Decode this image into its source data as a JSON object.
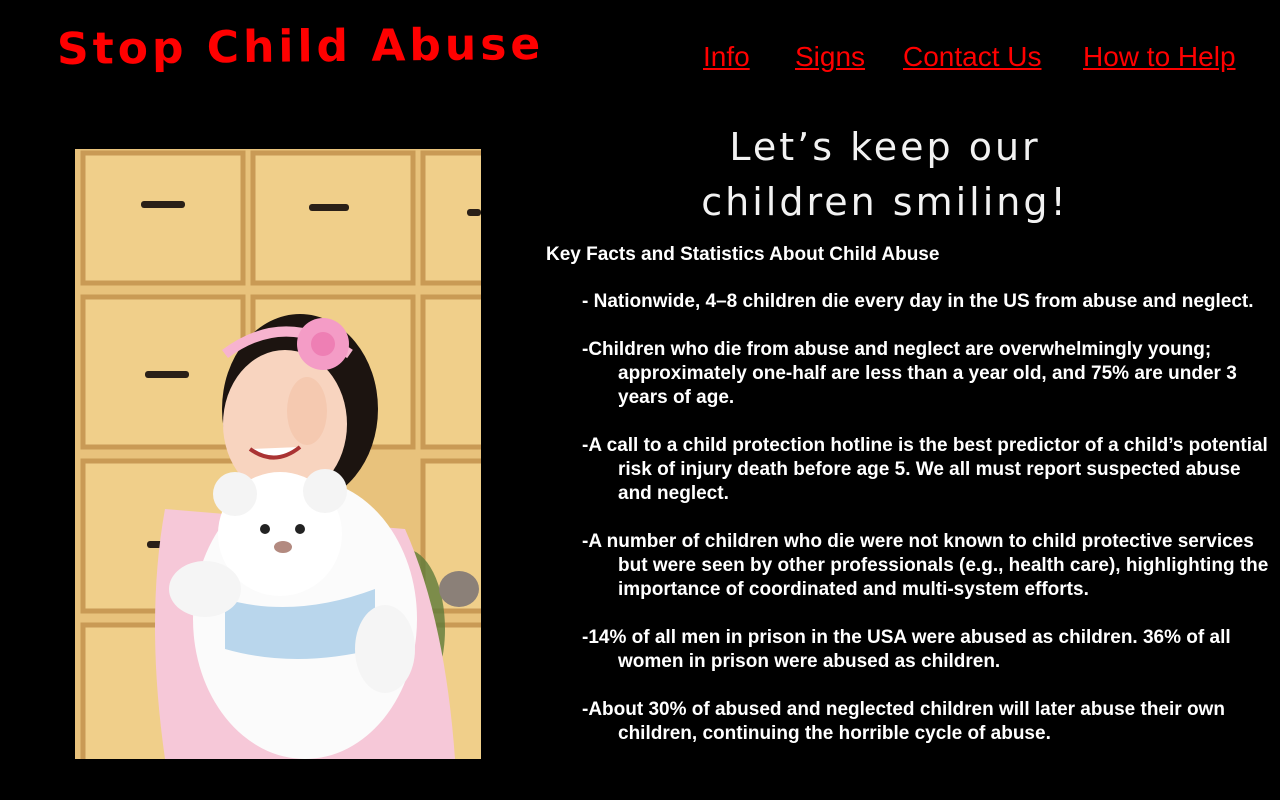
{
  "site": {
    "title": "Stop Child Abuse"
  },
  "nav": {
    "items": [
      {
        "label": "Info"
      },
      {
        "label": "Signs"
      },
      {
        "label": "Contact Us"
      },
      {
        "label": "How to Help"
      }
    ]
  },
  "hero": {
    "tagline_line1": "Let’s keep our",
    "tagline_line2": "children smiling!"
  },
  "facts": {
    "heading": "Key Facts and Statistics About Child Abuse",
    "items": [
      "- Nationwide, 4–8 children die every day in the US from abuse and neglect.",
      "-Children who die from abuse and neglect are overwhelmingly young; approximately one-half are less than a year old, and 75% are under 3 years of age.",
      "-A call to a child protection hotline is the best predictor of a child’s potential risk of injury death before age 5. We all must report suspected abuse and neglect.",
      "-A number of children who die were not known to child protective services but were seen by other professionals (e.g., health care), highlighting the importance of coordinated and multi-system efforts.",
      "-14% of all men in prison in the USA were abused as children. 36% of all women in prison were abused as children.",
      "-About 30% of abused and neglected children will later abuse their own children, continuing the horrible cycle of abuse."
    ]
  },
  "colors": {
    "background": "#000000",
    "accent": "#ff0000",
    "text": "#ffffff"
  }
}
